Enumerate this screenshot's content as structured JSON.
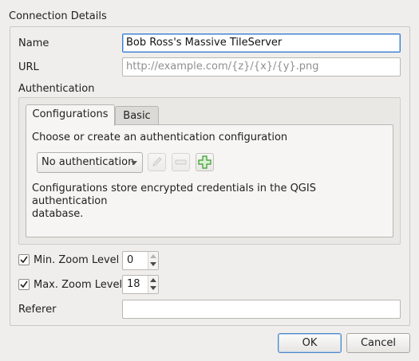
{
  "group": {
    "title": "Connection Details"
  },
  "name": {
    "label": "Name",
    "value": "Bob Ross's Massive TileServer"
  },
  "url": {
    "label": "URL",
    "placeholder": "http://example.com/{z}/{x}/{y}.png"
  },
  "authentication": {
    "label": "Authentication",
    "tabs": [
      {
        "label": "Configurations"
      },
      {
        "label": "Basic"
      }
    ],
    "prompt": "Choose or create an authentication configuration",
    "selected_config": "No authentication",
    "description_line1": "Configurations store encrypted credentials in the QGIS authentication",
    "description_line2": "database.",
    "icons": [
      "edit-pencil-icon",
      "remove-minus-icon",
      "add-plus-icon"
    ]
  },
  "min_zoom": {
    "label": "Min. Zoom Level",
    "checked": true,
    "value": "0"
  },
  "max_zoom": {
    "label": "Max. Zoom Level",
    "checked": true,
    "value": "18"
  },
  "referer": {
    "label": "Referer",
    "value": ""
  },
  "buttons": {
    "ok": "OK",
    "cancel": "Cancel"
  },
  "colors": {
    "background": "#efeeec",
    "focus": "#3a7fcd",
    "add_icon": "#3b9a2f"
  }
}
